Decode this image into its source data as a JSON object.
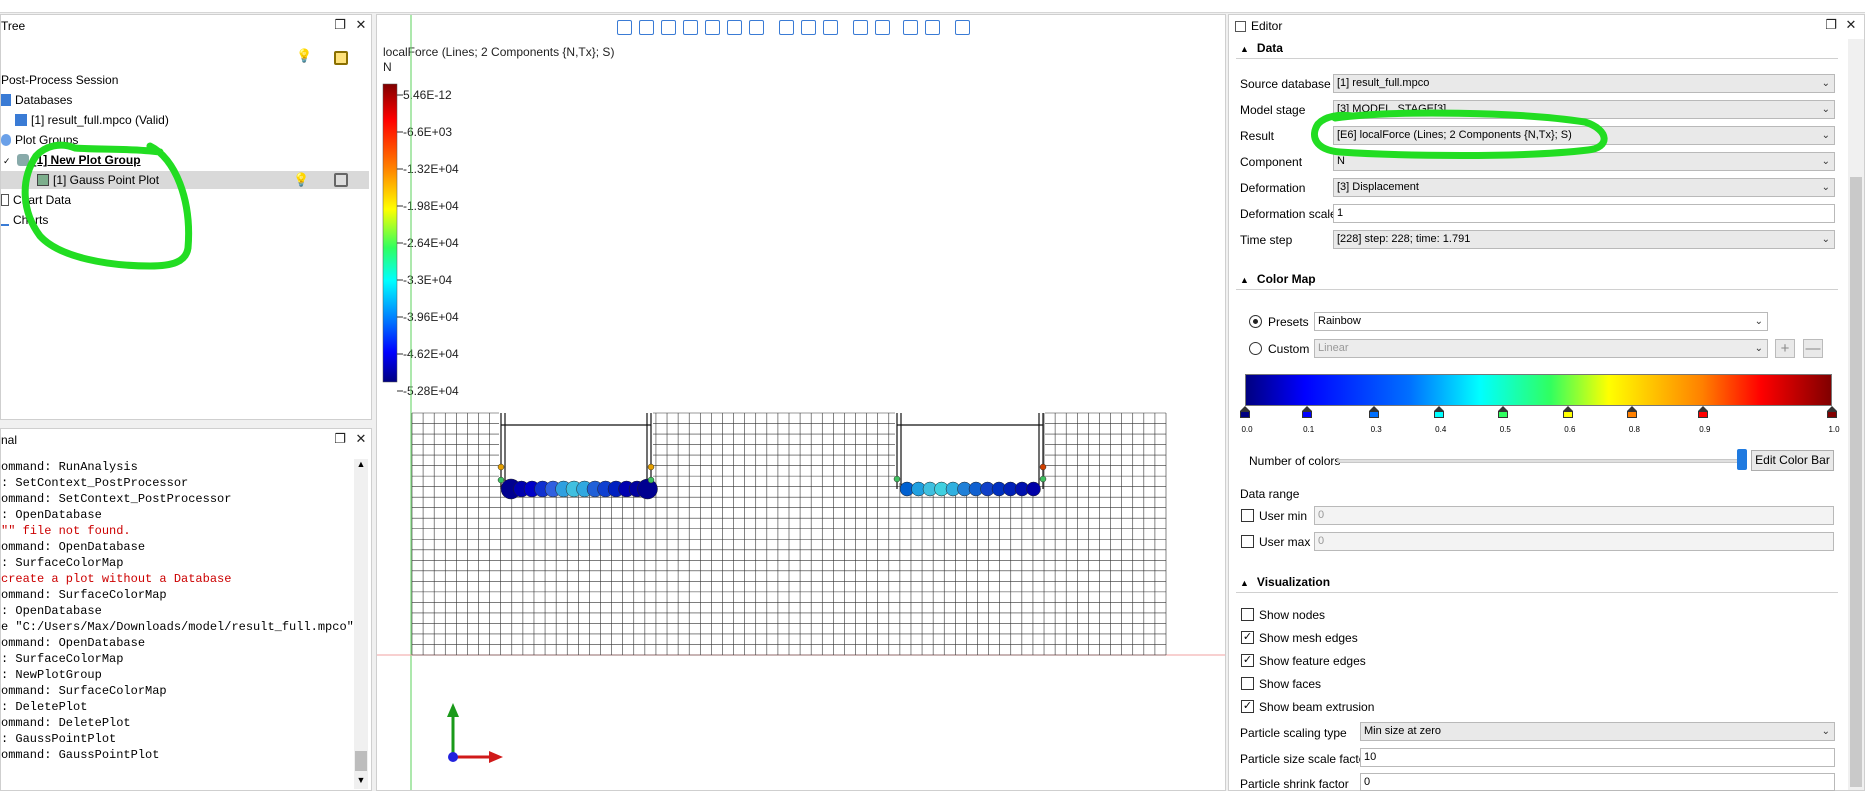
{
  "tree": {
    "title": "Tree",
    "items": [
      {
        "label": "Post-Process Session"
      },
      {
        "label": "Databases"
      },
      {
        "label": "[1] result_full.mpco (Valid)"
      },
      {
        "label": "Plot Groups"
      },
      {
        "label": "[1] New Plot Group"
      },
      {
        "label": "[1] Gauss Point Plot"
      },
      {
        "label": "Chart Data"
      },
      {
        "label": "Charts"
      }
    ]
  },
  "terminal": {
    "title": "Terminal",
    "lines": [
      "ommand: RunAnalysis",
      ": SetContext_PostProcessor",
      "ommand: SetContext_PostProcessor",
      ": OpenDatabase",
      "\"\" file not found.",
      "ommand: OpenDatabase",
      ": SurfaceColorMap",
      "create a plot without a Database",
      "ommand: SurfaceColorMap",
      ": OpenDatabase",
      "e \"C:/Users/Max/Downloads/model/result_full.mpco\"",
      "ommand: OpenDatabase",
      ": SurfaceColorMap",
      ": NewPlotGroup",
      "ommand: SurfaceColorMap",
      ": DeletePlot",
      "ommand: DeletePlot",
      ": GaussPointPlot",
      "ommand: GaussPointPlot"
    ],
    "error_color": "#cc0000"
  },
  "viewport": {
    "title": "localForce (Lines; 2 Components {N,Tx}; S)",
    "unit": "N",
    "legend_labels": [
      "5.46E-12",
      "-6.6E+03",
      "-1.32E+04",
      "-1.98E+04",
      "-2.64E+04",
      "-3.3E+04",
      "-3.96E+04",
      "-4.62E+04",
      "-5.28E+04"
    ]
  },
  "editor": {
    "title": "Editor",
    "data_section": "Data",
    "rows": [
      {
        "label": "Source database",
        "value": "[1] result_full.mpco"
      },
      {
        "label": "Model stage",
        "value": "[3] MODEL_STAGE[3]"
      },
      {
        "label": "Result",
        "value": "[E6] localForce (Lines; 2 Components {N,Tx}; S)"
      },
      {
        "label": "Component",
        "value": "N"
      },
      {
        "label": "Deformation",
        "value": "[3] Displacement"
      },
      {
        "label": "Deformation scale",
        "value": "1"
      },
      {
        "label": "Time step",
        "value": "[228] step: 228; time: 1.791"
      }
    ],
    "colormap_section": "Color Map",
    "presets_label": "Presets",
    "presets_value": "Rainbow",
    "custom_label": "Custom",
    "custom_value": "Linear",
    "stops": [
      "0.0",
      "0.1",
      "0.3",
      "0.4",
      "0.5",
      "0.6",
      "0.8",
      "0.9",
      "1.0"
    ],
    "stop_colors": [
      "#000080",
      "#0000ff",
      "#0070ff",
      "#00ffff",
      "#30ff60",
      "#ffff00",
      "#ff8000",
      "#ff0000",
      "#800000"
    ],
    "number_of_colors_label": "Number of colors",
    "edit_color_bar": "Edit Color Bar",
    "data_range_label": "Data range",
    "user_min_label": "User min",
    "user_min_value": "0",
    "user_max_label": "User max",
    "user_max_value": "0",
    "visualization_section": "Visualization",
    "checks": [
      {
        "label": "Show nodes",
        "checked": false
      },
      {
        "label": "Show mesh edges",
        "checked": true
      },
      {
        "label": "Show feature edges",
        "checked": true
      },
      {
        "label": "Show faces",
        "checked": false
      },
      {
        "label": "Show beam extrusion",
        "checked": true
      }
    ],
    "particle_scaling_label": "Particle scaling type",
    "particle_scaling_value": "Min size at zero",
    "particle_size_label": "Particle size scale factor",
    "particle_size_value": "10",
    "particle_shrink_label": "Particle shrink factor",
    "particle_shrink_value": "0"
  },
  "annotation_color": "#22dd22"
}
